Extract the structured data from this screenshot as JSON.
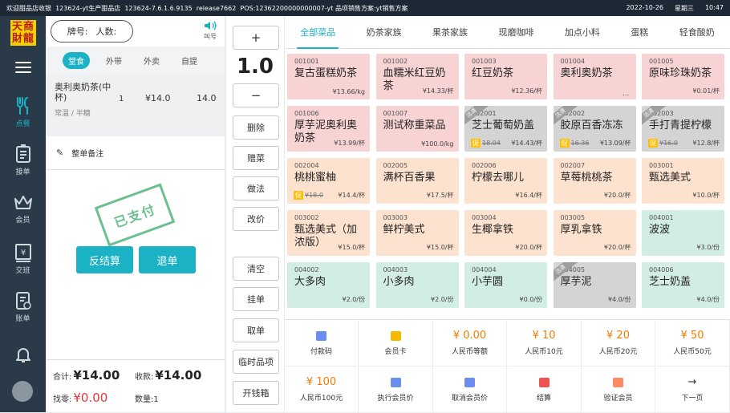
{
  "status": {
    "welcome": "欢迎甜品店收银",
    "store": "123624-yt生产甜品店",
    "version": "123624-7.6.1.6.9135",
    "release": "release7662",
    "pos": "POS:12362200000000007-yt",
    "plan": "品项销售方案:yt销售方案",
    "date": "2022-10-26",
    "weekday": "星期三",
    "time": "10:47"
  },
  "nav": {
    "logo": "天商财龍",
    "items": [
      {
        "label": "点餐",
        "icon": "utensils-icon"
      },
      {
        "label": "接单",
        "icon": "order-icon"
      },
      {
        "label": "会员",
        "icon": "crown-icon"
      },
      {
        "label": "交班",
        "icon": "shift-icon"
      },
      {
        "label": "账单",
        "icon": "bill-icon"
      },
      {
        "label": "",
        "icon": "bell-icon"
      }
    ]
  },
  "order": {
    "table_label": "牌号:",
    "people_label": "人数:",
    "call_label": "叫号",
    "tabs": [
      "堂食",
      "外带",
      "外卖",
      "自提"
    ],
    "item": {
      "name": "奥利奥奶茶(中杯)",
      "qty": "1",
      "price": "¥14.0",
      "total": "14.0",
      "spec": "常温 / 半糖"
    },
    "note_label": "整单备注",
    "stamp": "已支付",
    "reverse_btn": "反结算",
    "refund_btn": "退单",
    "total_label": "合计:",
    "total_value": "¥14.00",
    "received_label": "收款:",
    "received_value": "¥14.00",
    "change_label": "找零:",
    "change_value": "¥0.00",
    "count_label": "数量:1"
  },
  "actions": {
    "plus": "+",
    "qty": "1.0",
    "minus": "−",
    "buttons": [
      "删除",
      "赠菜",
      "做法",
      "改价",
      "清空",
      "挂单",
      "取单",
      "临时品项",
      "开钱箱"
    ]
  },
  "categories": [
    "全部菜品",
    "奶茶家族",
    "果茶家族",
    "现磨咖啡",
    "加点小料",
    "蛋糕",
    "轻食酸奶"
  ],
  "products": [
    {
      "code": "001001",
      "name": "复古蛋糕奶茶",
      "price": "¥13.66/kg",
      "color": "pink"
    },
    {
      "code": "001002",
      "name": "血糯米红豆奶茶",
      "price": "¥14.33/杯",
      "color": "pink"
    },
    {
      "code": "001003",
      "name": "红豆奶茶",
      "price": "¥12.36/杯",
      "color": "pink"
    },
    {
      "code": "001004",
      "name": "奥利奥奶茶",
      "price": "",
      "ellipsis": "...",
      "color": "pink"
    },
    {
      "code": "001005",
      "name": "原味珍珠奶茶",
      "price": "¥0.01/杯",
      "color": "pink"
    },
    {
      "code": "001006",
      "name": "厚芋泥奥利奥奶茶",
      "price": "¥13.99/杯",
      "color": "pink"
    },
    {
      "code": "001007",
      "name": "测试称重菜品",
      "price": "¥100.0/kg",
      "color": "pink"
    },
    {
      "code": "002001",
      "name": "芝士葡萄奶盖",
      "old": "18.04",
      "price": "¥14.43/杯",
      "promo": "促",
      "ribbon": "沽清",
      "color": "gray"
    },
    {
      "code": "002002",
      "name": "胶原百香冻冻",
      "old": "16.36",
      "price": "¥13.09/杯",
      "promo": "促",
      "ribbon": "沽清",
      "color": "gray"
    },
    {
      "code": "002003",
      "name": "手打青提柠檬",
      "old": "¥16.0",
      "price": "¥12.8/杯",
      "promo": "促",
      "ribbon": "沽清",
      "color": "gray"
    },
    {
      "code": "002004",
      "name": "桃桃蜜柚",
      "old": "¥18.0",
      "price": "¥14.4/杯",
      "promo": "促",
      "color": "peach"
    },
    {
      "code": "002005",
      "name": "满杯百香果",
      "price": "¥17.5/杯",
      "color": "peach"
    },
    {
      "code": "002006",
      "name": "柠檬去哪儿",
      "price": "¥16.4/杯",
      "color": "peach"
    },
    {
      "code": "002007",
      "name": "草莓桃桃茶",
      "price": "¥20.0/杯",
      "color": "peach"
    },
    {
      "code": "003001",
      "name": "甄选美式",
      "price": "¥10.0/杯",
      "color": "peach"
    },
    {
      "code": "003002",
      "name": "甄选美式（加浓版）",
      "price": "¥15.0/杯",
      "color": "peach"
    },
    {
      "code": "003003",
      "name": "鲜柠美式",
      "price": "¥15.0/杯",
      "color": "peach"
    },
    {
      "code": "003004",
      "name": "生椰拿铁",
      "price": "¥20.0/杯",
      "color": "peach"
    },
    {
      "code": "003005",
      "name": "厚乳拿铁",
      "price": "¥20.0/杯",
      "color": "peach"
    },
    {
      "code": "004001",
      "name": "波波",
      "price": "¥3.0/份",
      "color": "green"
    },
    {
      "code": "004002",
      "name": "大多肉",
      "price": "¥2.0/份",
      "color": "green"
    },
    {
      "code": "004003",
      "name": "小多肉",
      "price": "¥2.0/份",
      "color": "green"
    },
    {
      "code": "004004",
      "name": "小芋圆",
      "price": "¥0.0/份",
      "color": "green"
    },
    {
      "code": "004005",
      "name": "厚芋泥",
      "price": "¥4.0/份",
      "ribbon": "沽清",
      "color": "gray"
    },
    {
      "code": "004006",
      "name": "芝士奶盖",
      "price": "¥4.0/份",
      "color": "green"
    }
  ],
  "payments": [
    {
      "amount": "",
      "label": "付款码",
      "icon": "qr-pay-icon",
      "icolor": "#6b8cf0"
    },
    {
      "amount": "",
      "label": "会员卡",
      "icon": "member-card-icon",
      "icolor": "#f5b800"
    },
    {
      "amount": "¥ 0.00",
      "label": "人民币等额",
      "icon": "",
      "icolor": ""
    },
    {
      "amount": "¥ 10",
      "label": "人民币10元",
      "icon": "",
      "icolor": ""
    },
    {
      "amount": "¥ 20",
      "label": "人民币20元",
      "icon": "",
      "icolor": ""
    },
    {
      "amount": "¥ 50",
      "label": "人民币50元",
      "icon": "",
      "icolor": ""
    },
    {
      "amount": "¥ 100",
      "label": "人民币100元",
      "icon": "",
      "icolor": ""
    },
    {
      "amount": "",
      "label": "执行会员价",
      "icon": "member-price-icon",
      "icolor": "#6b8cf0"
    },
    {
      "amount": "",
      "label": "取消会员价",
      "icon": "cancel-member-icon",
      "icolor": "#6b8cf0"
    },
    {
      "amount": "",
      "label": "结算",
      "icon": "settle-icon",
      "icolor": "#ef5350"
    },
    {
      "amount": "",
      "label": "验证会员",
      "icon": "verify-member-icon",
      "icolor": "#ff8a65"
    },
    {
      "amount": "→",
      "label": "下一页",
      "icon": "arrow-right-icon",
      "icolor": ""
    }
  ]
}
